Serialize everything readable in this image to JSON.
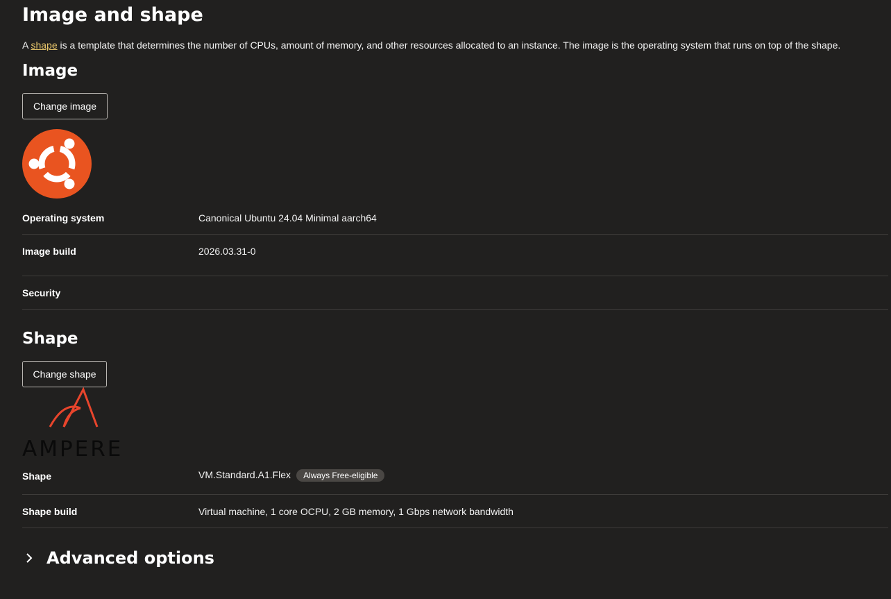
{
  "page": {
    "title": "Image and shape",
    "intro": {
      "prefix": "A ",
      "link": "shape",
      "suffix": " is a template that determines the number of CPUs, amount of memory, and other resources allocated to an instance. The image is the operating system that runs on top of the shape."
    }
  },
  "image": {
    "heading": "Image",
    "change_button": "Change image",
    "logo": "ubuntu-logo",
    "logo_color": "#e95420",
    "rows": {
      "os_label": "Operating system",
      "os_value": "Canonical Ubuntu 24.04 Minimal aarch64",
      "build_label": "Image build",
      "build_value": "2026.03.31-0",
      "security_label": "Security",
      "security_value": ""
    }
  },
  "shape": {
    "heading": "Shape",
    "change_button": "Change shape",
    "logo": "ampere-logo",
    "logo_text": "AMPERE",
    "logo_color": "#e8452c",
    "rows": {
      "shape_label": "Shape",
      "shape_value": "VM.Standard.A1.Flex",
      "shape_badge": "Always Free-eligible",
      "build_label": "Shape build",
      "build_value": "Virtual machine, 1 core OCPU, 2 GB memory, 1 Gbps network bandwidth"
    }
  },
  "advanced": {
    "label": "Advanced options",
    "icon": "chevron-right-icon"
  }
}
